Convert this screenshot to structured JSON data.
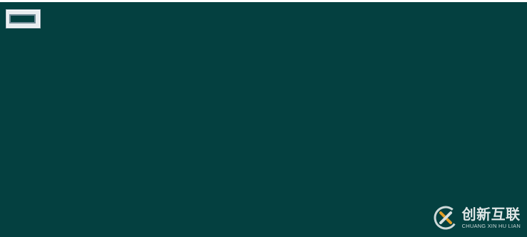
{
  "watermark": {
    "name_cn": "创新互联",
    "name_en": "CHUANG XIN HU LIAN",
    "logo_icon": "cx-circle-logo-icon",
    "accent_color": "#f5a623"
  },
  "colors": {
    "background": "#044040",
    "box_fill": "#e8ecef",
    "box_border": "#6f8a95"
  }
}
